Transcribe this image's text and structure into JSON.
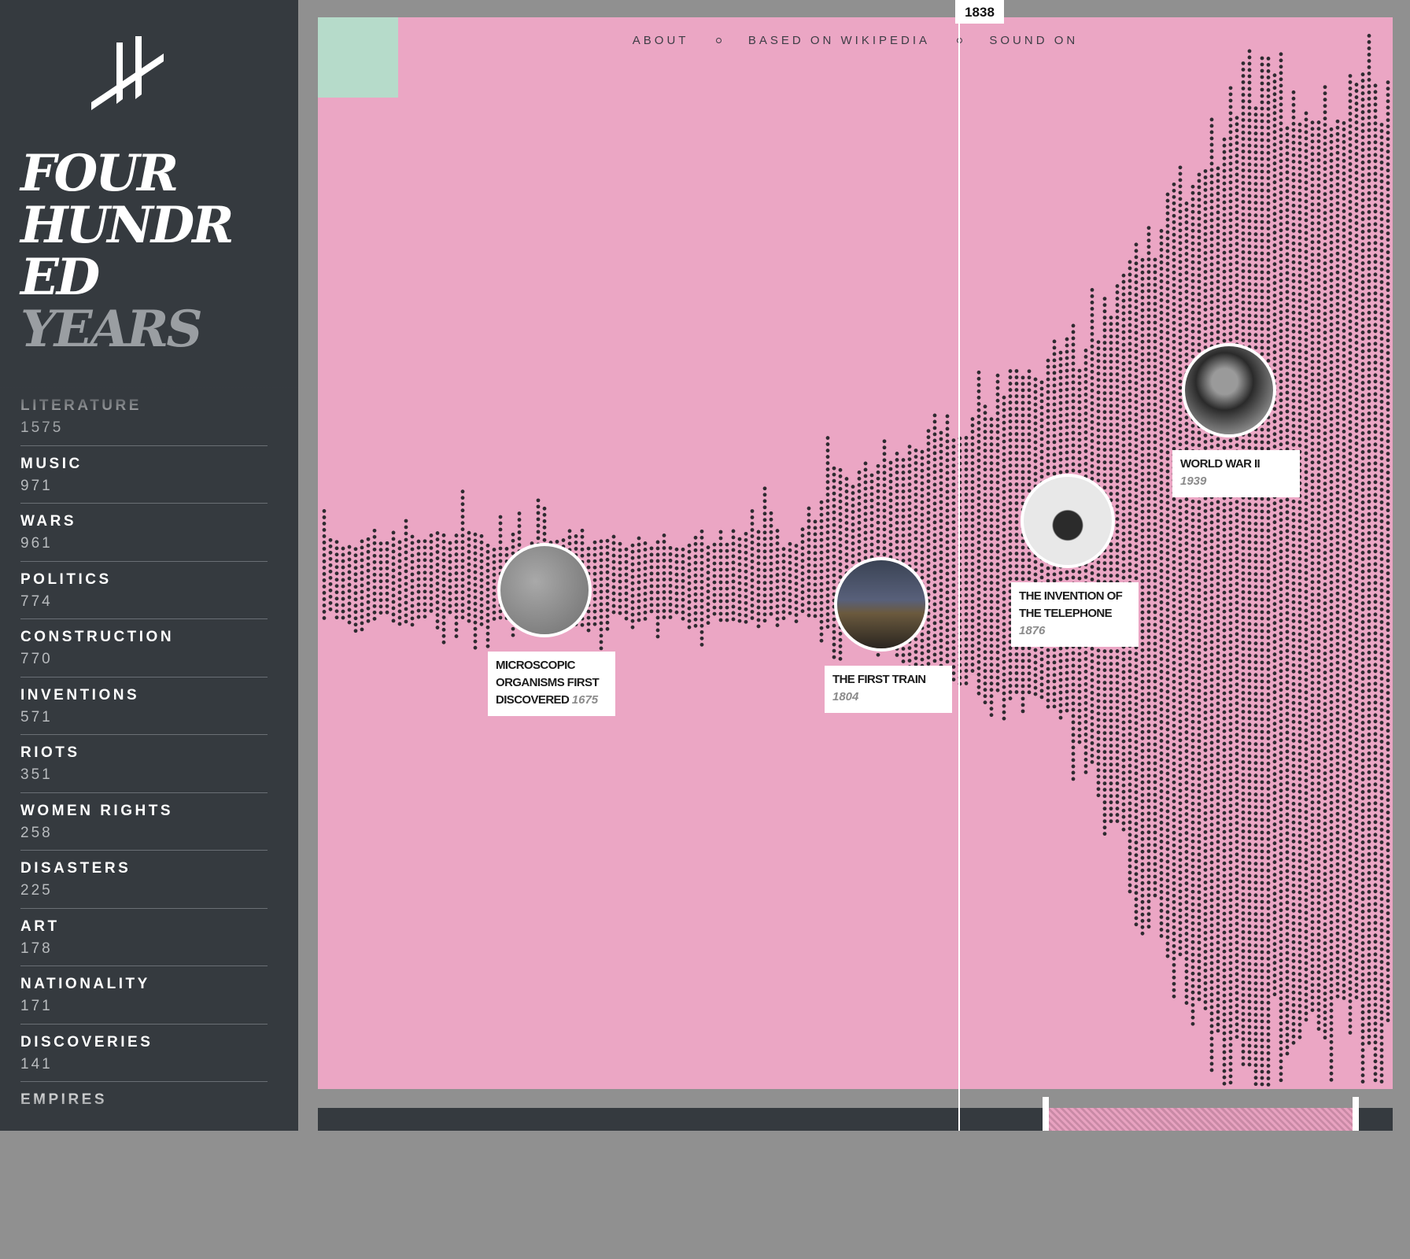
{
  "sidebar": {
    "title_lines": [
      "FOUR",
      "HUNDR",
      "ED",
      "YEARS"
    ],
    "categories": [
      {
        "name": "LITERATURE",
        "count": "1575"
      },
      {
        "name": "MUSIC",
        "count": "971"
      },
      {
        "name": "WARS",
        "count": "961"
      },
      {
        "name": "POLITICS",
        "count": "774"
      },
      {
        "name": "CONSTRUCTION",
        "count": "770"
      },
      {
        "name": "INVENTIONS",
        "count": "571"
      },
      {
        "name": "RIOTS",
        "count": "351"
      },
      {
        "name": "WOMEN RIGHTS",
        "count": "258"
      },
      {
        "name": "DISASTERS",
        "count": "225"
      },
      {
        "name": "ART",
        "count": "178"
      },
      {
        "name": "NATIONALITY",
        "count": "171"
      },
      {
        "name": "DISCOVERIES",
        "count": "141"
      },
      {
        "name": "EMPIRES",
        "count": ""
      }
    ]
  },
  "nav": {
    "about": "ABOUT",
    "source": "BASED ON WIKIPEDIA",
    "sound": "SOUND ON"
  },
  "cursor": {
    "year": "1838"
  },
  "events": [
    {
      "title": "MICROSCOPIC ORGANISMS FIRST DISCOVERED",
      "year": "1675",
      "image": "microscopic-organisms-photo"
    },
    {
      "title": "THE FIRST TRAIN",
      "year": "1804",
      "image": "train-bridge-photo"
    },
    {
      "title": "THE INVENTION OF THE TELEPHONE",
      "year": "1876",
      "image": "telephone-photo"
    },
    {
      "title": "WORLD WAR II",
      "year": "1939",
      "image": "world-war-ii-photo"
    }
  ],
  "colors": {
    "sidebar_bg": "#353a3f",
    "viz_bg": "#eba6c4",
    "mint": "#b6dbca",
    "dot": "#2e2a30"
  }
}
